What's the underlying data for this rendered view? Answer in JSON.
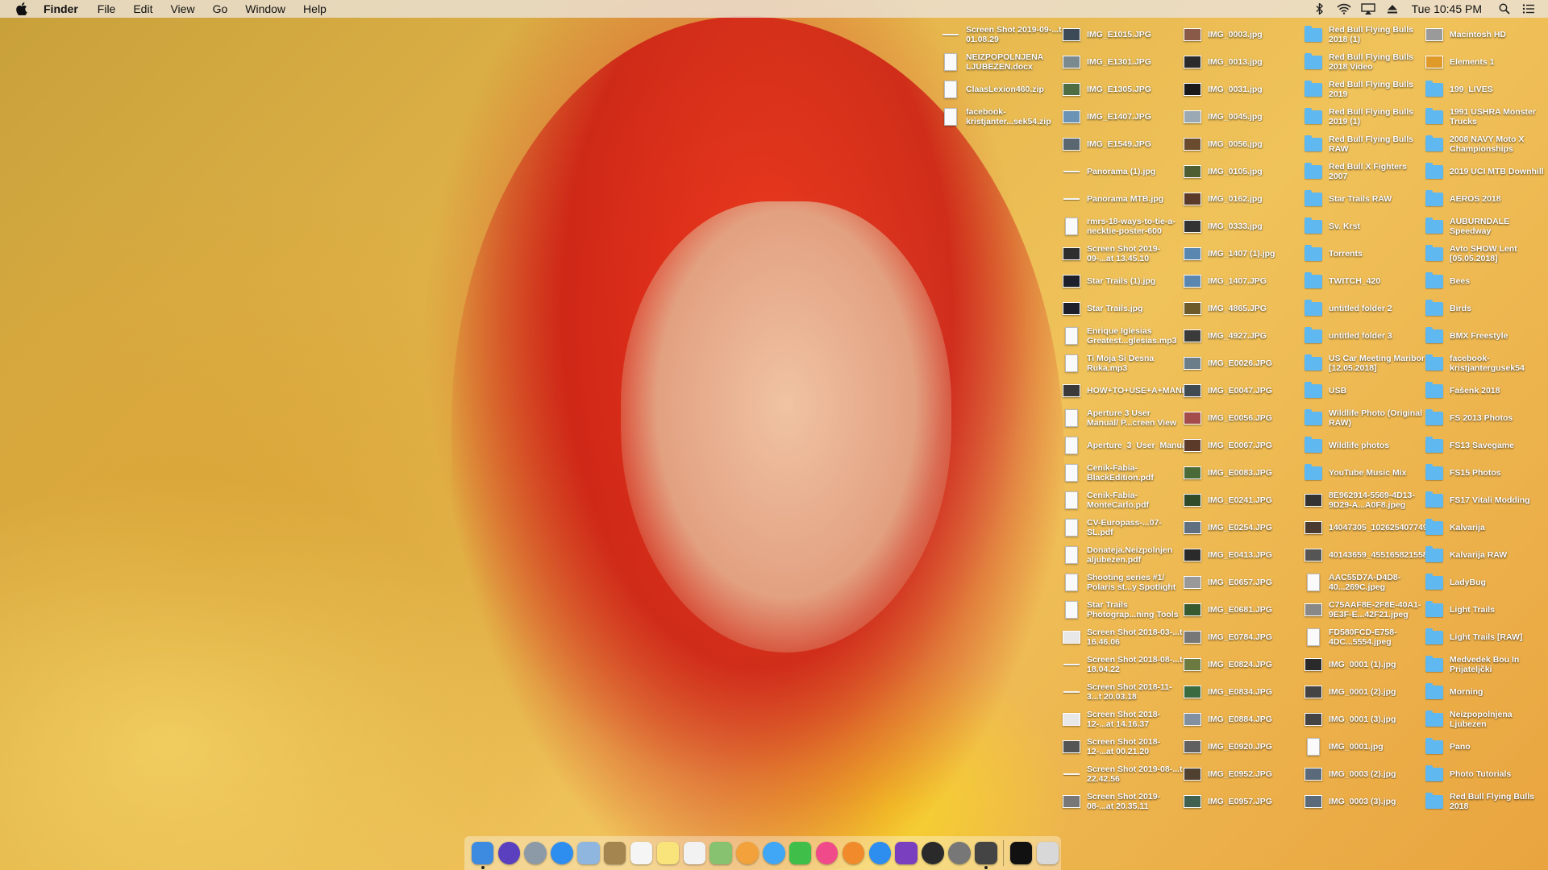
{
  "menubar": {
    "app_name": "Finder",
    "menus": [
      "File",
      "Edit",
      "View",
      "Go",
      "Window",
      "Help"
    ],
    "clock": "Tue 10:45 PM",
    "status_icons": [
      "bluetooth-icon",
      "wifi-icon",
      "airplay-icon",
      "eject-icon"
    ]
  },
  "desktop": {
    "col1": [
      {
        "label": "Screen Shot 2019-09-...t 01.08.29",
        "kind": "line"
      },
      {
        "label": "NEIZPOPOLNJENA LJUBEZEN.docx",
        "kind": "doc"
      },
      {
        "label": "ClaasLexion460.zip",
        "kind": "doc"
      },
      {
        "label": "facebook-kristjanter...sek54.zip",
        "kind": "doc"
      }
    ],
    "col2": [
      {
        "label": "IMG_E1015.JPG",
        "kind": "thumb",
        "color": "#3b4a56"
      },
      {
        "label": "IMG_E1301.JPG",
        "kind": "thumb",
        "color": "#7b8a8f"
      },
      {
        "label": "IMG_E1305.JPG",
        "kind": "thumb",
        "color": "#4f6d43"
      },
      {
        "label": "IMG_E1407.JPG",
        "kind": "thumb",
        "color": "#6b93b6"
      },
      {
        "label": "IMG_E1549.JPG",
        "kind": "thumb",
        "color": "#5a6770"
      },
      {
        "label": "Panorama (1).jpg",
        "kind": "line"
      },
      {
        "label": "Panorama MTB.jpg",
        "kind": "line"
      },
      {
        "label": "rmrs-18-ways-to-tie-a-necktie-poster-600",
        "kind": "doc"
      },
      {
        "label": "Screen Shot 2019-09-...at 13.45.10",
        "kind": "thumb",
        "color": "#2e2e2e"
      },
      {
        "label": "Star Trails (1).jpg",
        "kind": "thumb",
        "color": "#1d1f2a"
      },
      {
        "label": "Star Trails.jpg",
        "kind": "thumb",
        "color": "#1d1f2a"
      },
      {
        "label": "Enrique Iglesias Greatest...glesias.mp3",
        "kind": "doc"
      },
      {
        "label": "Ti Moja Si Desna Ruka.mp3",
        "kind": "doc"
      },
      {
        "label": "HOW+TO+USE+A+MANFROTTO...IPOD.mp4",
        "kind": "thumb",
        "color": "#3a3a3a"
      },
      {
        "label": "Aperture 3 User Manual/ P...creen View",
        "kind": "doc"
      },
      {
        "label": "Aperture_3_User_Manual.pdf",
        "kind": "doc"
      },
      {
        "label": "Cenik-Fabia-BlackEdition.pdf",
        "kind": "doc"
      },
      {
        "label": "Cenik-Fabia-MonteCarlo.pdf",
        "kind": "doc"
      },
      {
        "label": "CV-Europass-...07-SL.pdf",
        "kind": "doc"
      },
      {
        "label": "Donateja.Neizpolnjen aljubezen.pdf",
        "kind": "doc"
      },
      {
        "label": "Shooting series #1/ Polaris st...y Spotlight",
        "kind": "doc"
      },
      {
        "label": "Star Trails Photograp...ning Tools",
        "kind": "doc"
      },
      {
        "label": "Screen Shot 2018-03-...t 16.46.06",
        "kind": "thumb",
        "color": "#e8e8e8"
      },
      {
        "label": "Screen Shot 2018-08-...t 18.04.22",
        "kind": "line"
      },
      {
        "label": "Screen Shot 2018-11-3...t 20.03.18",
        "kind": "line"
      },
      {
        "label": "Screen Shot 2018-12-...at 14.16.37",
        "kind": "thumb",
        "color": "#e8e8e8"
      },
      {
        "label": "Screen Shot 2018-12-...at 00.21.20",
        "kind": "thumb",
        "color": "#555"
      },
      {
        "label": "Screen Shot 2019-08-...t 22.42.56",
        "kind": "line"
      },
      {
        "label": "Screen Shot 2019-08-...at 20.35.11",
        "kind": "thumb",
        "color": "#777"
      }
    ],
    "col3": [
      {
        "label": "IMG_0003.jpg",
        "kind": "thumb",
        "color": "#8a5a48"
      },
      {
        "label": "IMG_0013.jpg",
        "kind": "thumb",
        "color": "#2b2b2b"
      },
      {
        "label": "IMG_0031.jpg",
        "kind": "thumb",
        "color": "#1a1a1a"
      },
      {
        "label": "IMG_0045.jpg",
        "kind": "thumb",
        "color": "#9aa9b3"
      },
      {
        "label": "IMG_0056.jpg",
        "kind": "thumb",
        "color": "#6b4b2e"
      },
      {
        "label": "IMG_0105.jpg",
        "kind": "thumb",
        "color": "#4d5e33"
      },
      {
        "label": "IMG_0162.jpg",
        "kind": "thumb",
        "color": "#5b3a2a"
      },
      {
        "label": "IMG_0333.jpg",
        "kind": "thumb",
        "color": "#333"
      },
      {
        "label": "IMG_1407 (1).jpg",
        "kind": "thumb",
        "color": "#5a87b0"
      },
      {
        "label": "IMG_1407.JPG",
        "kind": "thumb",
        "color": "#5a87b0"
      },
      {
        "label": "IMG_4865.JPG",
        "kind": "thumb",
        "color": "#6d5a2a"
      },
      {
        "label": "IMG_4927.JPG",
        "kind": "thumb",
        "color": "#3a3a3a"
      },
      {
        "label": "IMG_E0026.JPG",
        "kind": "thumb",
        "color": "#6b7d88"
      },
      {
        "label": "IMG_E0047.JPG",
        "kind": "thumb",
        "color": "#404a52"
      },
      {
        "label": "IMG_E0056.JPG",
        "kind": "thumb",
        "color": "#a44c4c"
      },
      {
        "label": "IMG_E0067.JPG",
        "kind": "thumb",
        "color": "#5c3a2a"
      },
      {
        "label": "IMG_E0083.JPG",
        "kind": "thumb",
        "color": "#4a6a38"
      },
      {
        "label": "IMG_E0241.JPG",
        "kind": "thumb",
        "color": "#2f4b2a"
      },
      {
        "label": "IMG_E0254.JPG",
        "kind": "thumb",
        "color": "#607080"
      },
      {
        "label": "IMG_E0413.JPG",
        "kind": "thumb",
        "color": "#2a2a2a"
      },
      {
        "label": "IMG_E0657.JPG",
        "kind": "thumb",
        "color": "#999"
      },
      {
        "label": "IMG_E0681.JPG",
        "kind": "thumb",
        "color": "#385a30"
      },
      {
        "label": "IMG_E0784.JPG",
        "kind": "thumb",
        "color": "#777"
      },
      {
        "label": "IMG_E0824.JPG",
        "kind": "thumb",
        "color": "#6a7a40"
      },
      {
        "label": "IMG_E0834.JPG",
        "kind": "thumb",
        "color": "#3a6a40"
      },
      {
        "label": "IMG_E0884.JPG",
        "kind": "thumb",
        "color": "#8090a0"
      },
      {
        "label": "IMG_E0920.JPG",
        "kind": "thumb",
        "color": "#606060"
      },
      {
        "label": "IMG_E0952.JPG",
        "kind": "thumb",
        "color": "#504030"
      },
      {
        "label": "IMG_E0957.JPG",
        "kind": "thumb",
        "color": "#406050"
      }
    ],
    "col4": [
      {
        "label": "Red Bull Flying Bulls 2018 (1)",
        "kind": "folder"
      },
      {
        "label": "Red Bull Flying Bulls 2018 Video",
        "kind": "folder"
      },
      {
        "label": "Red Bull Flying Bulls 2019",
        "kind": "folder"
      },
      {
        "label": "Red Bull Flying Bulls 2019 (1)",
        "kind": "folder"
      },
      {
        "label": "Red Bull Flying Bulls RAW",
        "kind": "folder"
      },
      {
        "label": "Red Bull X Fighters 2007",
        "kind": "folder"
      },
      {
        "label": "Star Trails RAW",
        "kind": "folder"
      },
      {
        "label": "Sv. Krst",
        "kind": "folder"
      },
      {
        "label": "Torrents",
        "kind": "folder"
      },
      {
        "label": "TWITCH_420",
        "kind": "folder"
      },
      {
        "label": "untitled folder 2",
        "kind": "folder"
      },
      {
        "label": "untitled folder 3",
        "kind": "folder"
      },
      {
        "label": "US Car Meeting Maribor [12.05.2018]",
        "kind": "folder"
      },
      {
        "label": "USB",
        "kind": "folder"
      },
      {
        "label": "Wildlife Photo (Original RAW)",
        "kind": "folder"
      },
      {
        "label": "Wildlife photos",
        "kind": "folder"
      },
      {
        "label": "YouTube Music Mix",
        "kind": "folder"
      },
      {
        "label": "8E962914-5569-4D13-9D29-A...A0F8.jpeg",
        "kind": "thumb",
        "color": "#333"
      },
      {
        "label": "14047305_1026254077493412...979_o.jpg",
        "kind": "thumb",
        "color": "#4a3a30"
      },
      {
        "label": "40143659_455165821558537...2980352_n",
        "kind": "thumb",
        "color": "#555"
      },
      {
        "label": "AAC55D7A-D4D8-40...269C.jpeg",
        "kind": "doc"
      },
      {
        "label": "C75AAF8E-2F8E-40A1-9E3F-E...42F21.jpeg",
        "kind": "thumb",
        "color": "#888"
      },
      {
        "label": "FD580FCD-E758-4DC...5554.jpeg",
        "kind": "doc"
      },
      {
        "label": "IMG_0001 (1).jpg",
        "kind": "thumb",
        "color": "#2a2a2a"
      },
      {
        "label": "IMG_0001 (2).jpg",
        "kind": "thumb",
        "color": "#444"
      },
      {
        "label": "IMG_0001 (3).jpg",
        "kind": "thumb",
        "color": "#444"
      },
      {
        "label": "IMG_0001.jpg",
        "kind": "doc"
      },
      {
        "label": "IMG_0003 (2).jpg",
        "kind": "thumb",
        "color": "#5a6a7a"
      },
      {
        "label": "IMG_0003 (3).jpg",
        "kind": "thumb",
        "color": "#5a6a7a"
      }
    ],
    "col5": [
      {
        "label": "Macintosh HD",
        "kind": "thumb",
        "color": "#9a9a9a"
      },
      {
        "label": "Elements 1",
        "kind": "thumb",
        "color": "#e09a2a"
      },
      {
        "label": "199_LIVES",
        "kind": "folder"
      },
      {
        "label": "1991 USHRA Monster Trucks",
        "kind": "folder"
      },
      {
        "label": "2008 NAVY Moto X Championships",
        "kind": "folder"
      },
      {
        "label": "2019 UCI MTB Downhill",
        "kind": "folder"
      },
      {
        "label": "AEROS 2018",
        "kind": "folder"
      },
      {
        "label": "AUBURNDALE Speedway",
        "kind": "folder"
      },
      {
        "label": "Avto SHOW Lent [05.05.2018]",
        "kind": "folder"
      },
      {
        "label": "Bees",
        "kind": "folder"
      },
      {
        "label": "Birds",
        "kind": "folder"
      },
      {
        "label": "BMX Freestyle",
        "kind": "folder"
      },
      {
        "label": "facebook-kristjantergusek54",
        "kind": "folder"
      },
      {
        "label": "Fašenk 2018",
        "kind": "folder"
      },
      {
        "label": "FS 2013 Photos",
        "kind": "folder"
      },
      {
        "label": "FS13 Savegame",
        "kind": "folder"
      },
      {
        "label": "FS15 Photos",
        "kind": "folder"
      },
      {
        "label": "FS17 Vitali Modding",
        "kind": "folder"
      },
      {
        "label": "Kalvarija",
        "kind": "folder"
      },
      {
        "label": "Kalvarija RAW",
        "kind": "folder"
      },
      {
        "label": "LadyBug",
        "kind": "folder"
      },
      {
        "label": "Light Trails",
        "kind": "folder"
      },
      {
        "label": "Light Trails [RAW]",
        "kind": "folder"
      },
      {
        "label": "Medvedek Bou In Prijateljčki",
        "kind": "folder"
      },
      {
        "label": "Morning",
        "kind": "folder"
      },
      {
        "label": "Neizpopolnjena Ljubezen",
        "kind": "folder"
      },
      {
        "label": "Pano",
        "kind": "folder"
      },
      {
        "label": "Photo Tutorials",
        "kind": "folder"
      },
      {
        "label": "Red Bull Flying Bulls 2018",
        "kind": "folder"
      }
    ]
  },
  "dock": {
    "apps": [
      {
        "name": "finder-app",
        "color": "#3c8be0",
        "round": false,
        "running": true
      },
      {
        "name": "siri-app",
        "color": "#5a3fbf",
        "round": true,
        "running": false
      },
      {
        "name": "launchpad-app",
        "color": "#8c9aa8",
        "round": true,
        "running": false
      },
      {
        "name": "safari-app",
        "color": "#2d8ef0",
        "round": true,
        "running": false
      },
      {
        "name": "mail-app",
        "color": "#8fb6df",
        "round": false,
        "running": false
      },
      {
        "name": "contacts-app",
        "color": "#a4844f",
        "round": false,
        "running": false
      },
      {
        "name": "calendar-app",
        "color": "#f5f5f5",
        "round": false,
        "running": false
      },
      {
        "name": "notes-app",
        "color": "#f8e47a",
        "round": false,
        "running": false
      },
      {
        "name": "reminders-app",
        "color": "#f2f2f2",
        "round": false,
        "running": false
      },
      {
        "name": "maps-app",
        "color": "#86c26f",
        "round": false,
        "running": false
      },
      {
        "name": "photos-app",
        "color": "#f3a23b",
        "round": true,
        "running": false
      },
      {
        "name": "messages-app",
        "color": "#3fa7f5",
        "round": true,
        "running": false
      },
      {
        "name": "facetime-app",
        "color": "#3fbf4a",
        "round": false,
        "running": false
      },
      {
        "name": "itunes-app",
        "color": "#f04a8a",
        "round": true,
        "running": false
      },
      {
        "name": "ibooks-app",
        "color": "#f08a2a",
        "round": true,
        "running": false
      },
      {
        "name": "app-store-app",
        "color": "#2d8ef0",
        "round": true,
        "running": false
      },
      {
        "name": "affinity-app",
        "color": "#7a3fbf",
        "round": false,
        "running": false
      },
      {
        "name": "camera-app",
        "color": "#2a2a2a",
        "round": true,
        "running": false
      },
      {
        "name": "system-preferences-app",
        "color": "#777",
        "round": true,
        "running": false
      },
      {
        "name": "activity-monitor-app",
        "color": "#444",
        "round": false,
        "running": true
      }
    ],
    "after_separator": [
      {
        "name": "terminal-app",
        "color": "#111",
        "round": false,
        "running": false
      },
      {
        "name": "trash",
        "color": "#d8d8d8",
        "round": false,
        "running": false
      }
    ]
  }
}
